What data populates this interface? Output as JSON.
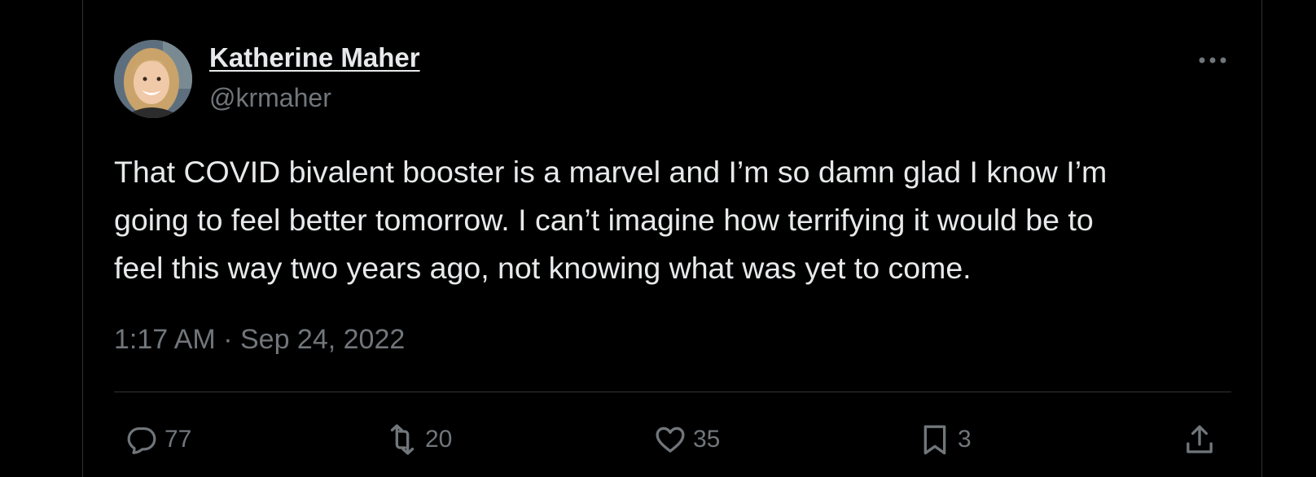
{
  "tweet": {
    "author_name": "Katherine Maher",
    "author_handle": "@krmaher",
    "text_lines": [
      "That COVID bivalent booster is a marvel and I’m so damn glad I know I’m",
      "going to feel better tomorrow. I can’t imagine how terrifying it would be to",
      "feel this way two years ago, not knowing what was yet to come."
    ],
    "time": "1:17 AM",
    "separator": "·",
    "date": "Sep 24, 2022"
  },
  "actions": {
    "replies": {
      "icon": "reply-icon",
      "count": "77"
    },
    "retweets": {
      "icon": "retweet-icon",
      "count": "20"
    },
    "likes": {
      "icon": "heart-icon",
      "count": "35"
    },
    "bookmarks": {
      "icon": "bookmark-icon",
      "count": "3"
    },
    "share": {
      "icon": "share-icon"
    }
  },
  "header": {
    "more_icon": "more-options-icon"
  },
  "colors": {
    "background": "#000000",
    "primary_text": "#e7e9ea",
    "secondary_text": "#71767b",
    "border": "#2f3336"
  }
}
